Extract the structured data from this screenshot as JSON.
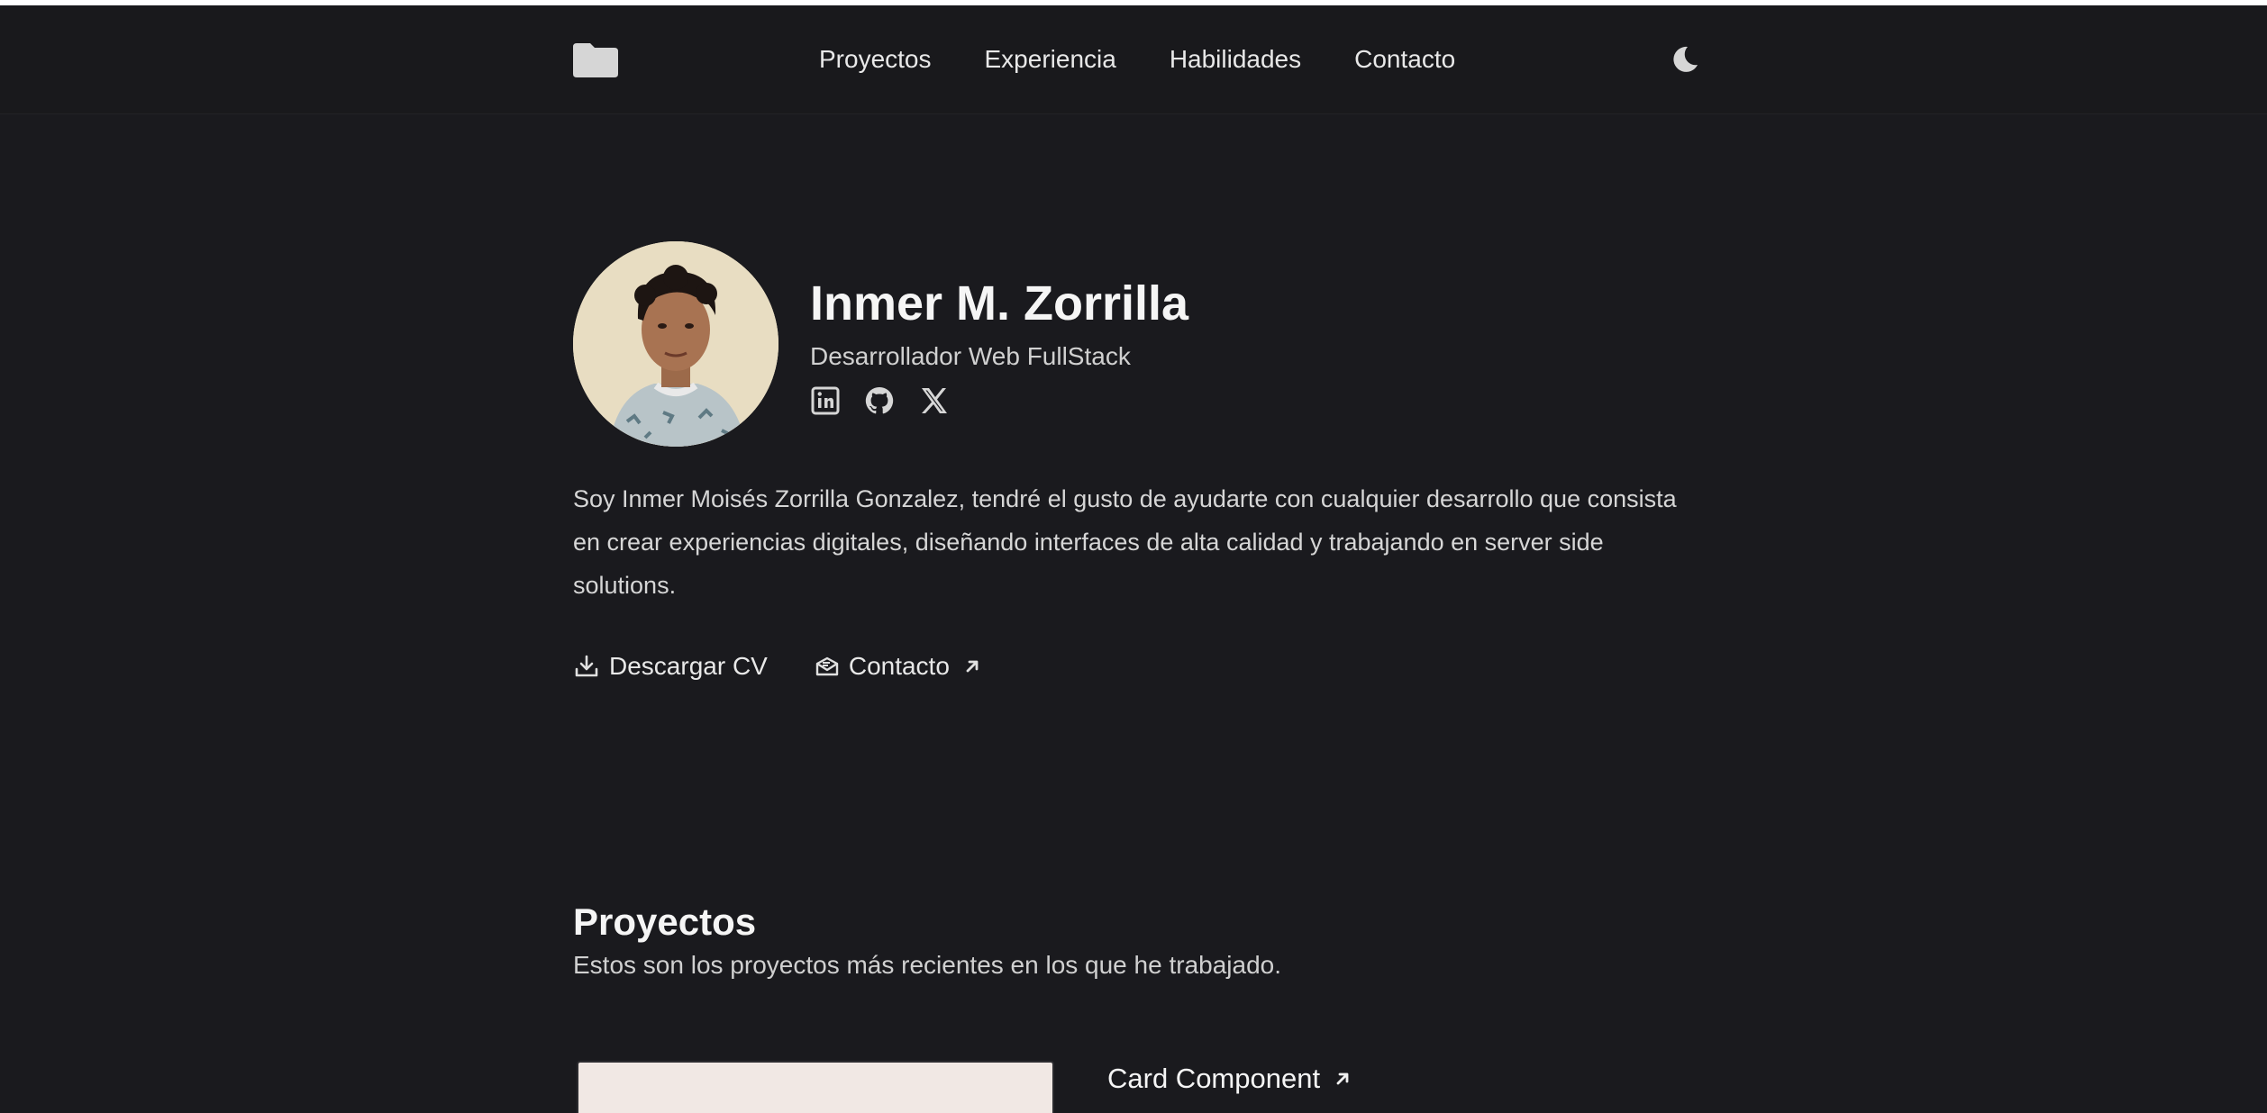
{
  "nav": {
    "logo_icon": "folder-icon",
    "links": [
      {
        "label": "Proyectos"
      },
      {
        "label": "Experiencia"
      },
      {
        "label": "Habilidades"
      },
      {
        "label": "Contacto"
      }
    ],
    "theme_icon": "moon-icon"
  },
  "hero": {
    "name": "Inmer M. Zorrilla",
    "role": "Desarrollador Web FullStack",
    "socials": [
      {
        "icon": "linkedin-icon"
      },
      {
        "icon": "github-icon"
      },
      {
        "icon": "x-icon"
      }
    ],
    "bio": "Soy Inmer Moisés Zorrilla Gonzalez, tendré el gusto de ayudarte con cualquier desarrollo que consista en crear experiencias digitales, diseñando interfaces de alta calidad y trabajando en server side solutions.",
    "download_label": "Descargar CV",
    "contact_label": "Contacto"
  },
  "projects": {
    "title": "Proyectos",
    "subtitle": "Estos son los proyectos más recientes en los que he trabajado.",
    "items": [
      {
        "title": "Card Component"
      }
    ]
  },
  "colors": {
    "background": "#1a1a1e",
    "text": "#e5e5e5",
    "heading": "#f5f5f5"
  }
}
